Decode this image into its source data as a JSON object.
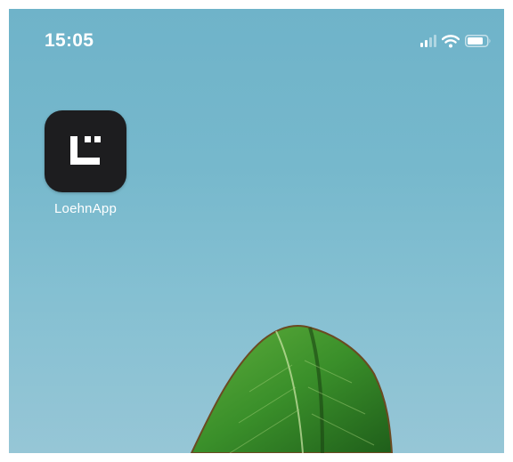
{
  "status_bar": {
    "time": "15:05",
    "icons": [
      "cellular-signal-icon",
      "wifi-icon",
      "battery-icon"
    ]
  },
  "home_screen": {
    "apps": [
      {
        "label": "LoehnApp",
        "icon": "loehnapp-logo-icon",
        "icon_background": "#1d1d1f"
      }
    ]
  },
  "wallpaper": {
    "subject": "leaf-icon",
    "sky_color": "#76b8cc"
  }
}
